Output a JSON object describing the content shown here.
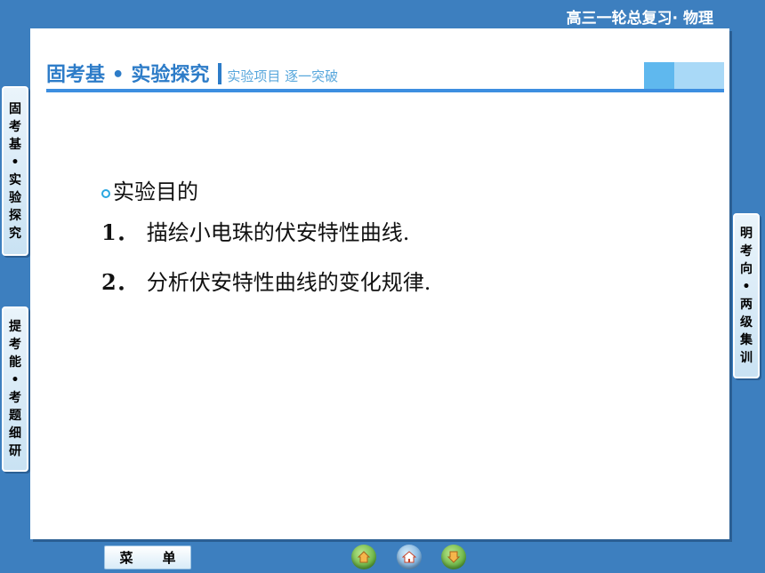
{
  "header": {
    "course_title": "高三一轮总复习· 物理"
  },
  "section": {
    "title": "固考基 • 实验探究",
    "subtitle": "实验项目  逐一突破"
  },
  "content": {
    "heading": "实验目的",
    "items": [
      {
        "num": "1．",
        "text": "描绘小电珠的伏安特性曲线."
      },
      {
        "num": "2．",
        "text": "分析伏安特性曲线的变化规律."
      }
    ]
  },
  "side_tabs": {
    "left_top": [
      "固",
      "考",
      "基",
      "•",
      "实",
      "验",
      "探",
      "究"
    ],
    "left_bottom": [
      "提",
      "考",
      "能",
      "•",
      "考",
      "题",
      "细",
      "研"
    ],
    "right": [
      "明",
      "考",
      "向",
      "•",
      "两",
      "级",
      "集",
      "训"
    ]
  },
  "footer": {
    "menu_label_1": "菜",
    "menu_label_2": "单"
  },
  "icons": {
    "prev": "prev-page-icon",
    "home": "home-icon",
    "next": "next-page-icon"
  },
  "colors": {
    "background": "#3d7fbf",
    "accent": "#2d7cc8"
  }
}
